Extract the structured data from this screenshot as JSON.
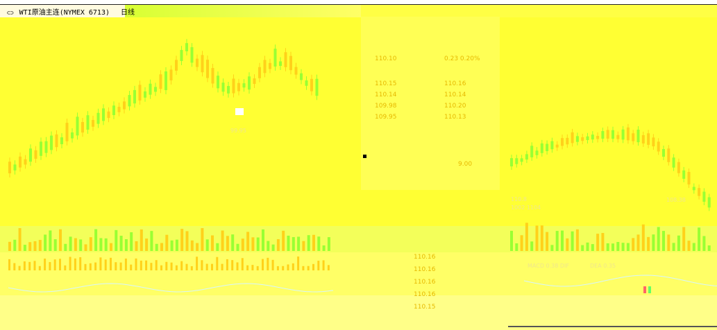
{
  "window": {
    "title": "WTI原油主连(NYMEX 6713)",
    "period_label": "日线",
    "link_icon": "chain-link-icon"
  },
  "quote_panel": {
    "rows": [
      {
        "label": "110.10",
        "value": "0.23 0.20%"
      },
      {
        "label": "110.15",
        "value": "110.16"
      },
      {
        "label": "110.14",
        "value": "110.14"
      },
      {
        "label": "109.98",
        "value": "110.20"
      },
      {
        "label": "109.95",
        "value": "110.13"
      }
    ],
    "bottom_value": "9.00"
  },
  "lower_values": [
    "110.16",
    "110.16",
    "110.16",
    "110.16",
    "110.15"
  ],
  "left_price_label": "99.95",
  "right_price_label": "108.38",
  "right_info": [
    "110.8",
    "1002 1104"
  ],
  "osc_info": [
    "MACD 0.38 DIF",
    "DEA 0.35"
  ],
  "colors": {
    "bg": "#ffff33",
    "up": "#ffd11a",
    "down": "#99ff33",
    "band": "#f3ff5a",
    "line": "#d6f5ff"
  }
}
